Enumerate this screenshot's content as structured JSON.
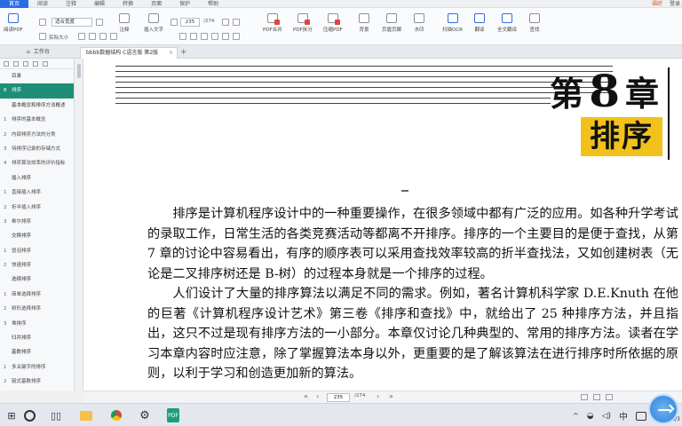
{
  "menu": {
    "items": [
      "首页",
      "阅读",
      "注释",
      "编辑",
      "转换",
      "页面",
      "保护",
      "帮助"
    ],
    "active_index": 0,
    "right": {
      "brand": "福昕",
      "login": "登录"
    }
  },
  "toolbar": {
    "read_pdf": "阅读PDF",
    "zoom_value": "适合宽度",
    "actual_size": "实际大小",
    "page_current": "235",
    "page_total": "/274",
    "comment": "注释",
    "insert_text": "插入文字",
    "pdf_merge": "PDF合并",
    "pdf_split": "PDF拆分",
    "compress_pdf": "压缩PDF",
    "background": "背景",
    "header_footer": "页眉页脚",
    "watermark": "水印",
    "ocr": "扫描OCR",
    "translate": "翻译",
    "full_translate": "全文翻译",
    "more": "查找"
  },
  "tabs": {
    "panel_label": "工作台",
    "doc_tab": "bbbb数据结构 C语言版 第2版",
    "plus": "+"
  },
  "sidebar": {
    "items": [
      {
        "num": "",
        "label": "目录",
        "type": "head"
      },
      {
        "num": "8",
        "label": "排序",
        "type": "selected"
      },
      {
        "num": "",
        "label": "基本概念和排序方法概述",
        "type": "head"
      },
      {
        "num": "1",
        "label": "排序的基本概念",
        "type": "item"
      },
      {
        "num": "2",
        "label": "内部排序方法的分类",
        "type": "item"
      },
      {
        "num": "3",
        "label": "待排序记录的存储方式",
        "type": "item"
      },
      {
        "num": "4",
        "label": "排序算法效率的评价指标",
        "type": "item"
      },
      {
        "num": "",
        "label": "插入排序",
        "type": "head"
      },
      {
        "num": "1",
        "label": "直接插入排序",
        "type": "item"
      },
      {
        "num": "2",
        "label": "折半插入排序",
        "type": "item"
      },
      {
        "num": "3",
        "label": "希尔排序",
        "type": "item"
      },
      {
        "num": "",
        "label": "交换排序",
        "type": "head"
      },
      {
        "num": "1",
        "label": "冒泡排序",
        "type": "item"
      },
      {
        "num": "2",
        "label": "快速排序",
        "type": "item"
      },
      {
        "num": "",
        "label": "选择排序",
        "type": "head"
      },
      {
        "num": "1",
        "label": "简单选择排序",
        "type": "item"
      },
      {
        "num": "2",
        "label": "树形选择排序",
        "type": "item"
      },
      {
        "num": "3",
        "label": "堆排序",
        "type": "item"
      },
      {
        "num": "",
        "label": "归并排序",
        "type": "head"
      },
      {
        "num": "",
        "label": "基数排序",
        "type": "head"
      },
      {
        "num": "1",
        "label": "多关键字的排序",
        "type": "item"
      },
      {
        "num": "2",
        "label": "链式基数排序",
        "type": "item"
      }
    ]
  },
  "document": {
    "chapter_prefix": "第",
    "chapter_number": "8",
    "chapter_suffix": "章",
    "chapter_title": "排序",
    "paragraphs": [
      "排序是计算机程序设计中的一种重要操作，在很多领域中都有广泛的应用。如各种升学考试的录取工作，日常生活的各类竞赛活动等都离不开排序。排序的一个主要目的是便于查找，从第 7 章的讨论中容易看出，有序的顺序表可以采用查找效率较高的折半查找法，又如创建树表（无论是二叉排序树还是 B-树）的过程本身就是一个排序的过程。",
      "人们设计了大量的排序算法以满足不同的需求。例如，著名计算机科学家 D.E.Knuth 在他的巨著《计算机程序设计艺术》第三卷《排序和查找》中，就给出了 25 种排序方法，并且指出，这只不过是现有排序方法的一小部分。本章仅讨论几种典型的、常用的排序方法。读者在学习本章内容时应注意，除了掌握算法本身以外，更重要的是了解该算法在进行排序时所依据的原则，以利于学习和创造更加新的算法。"
    ]
  },
  "statusbar": {
    "page_current": "235",
    "page_total": "/274"
  },
  "taskbar": {
    "ime": "中",
    "date": "2022/4/3"
  },
  "colors": {
    "accent": "#2b6de0",
    "sidebar_selected": "#1e8e77",
    "chapter_box": "#f2c21a"
  }
}
